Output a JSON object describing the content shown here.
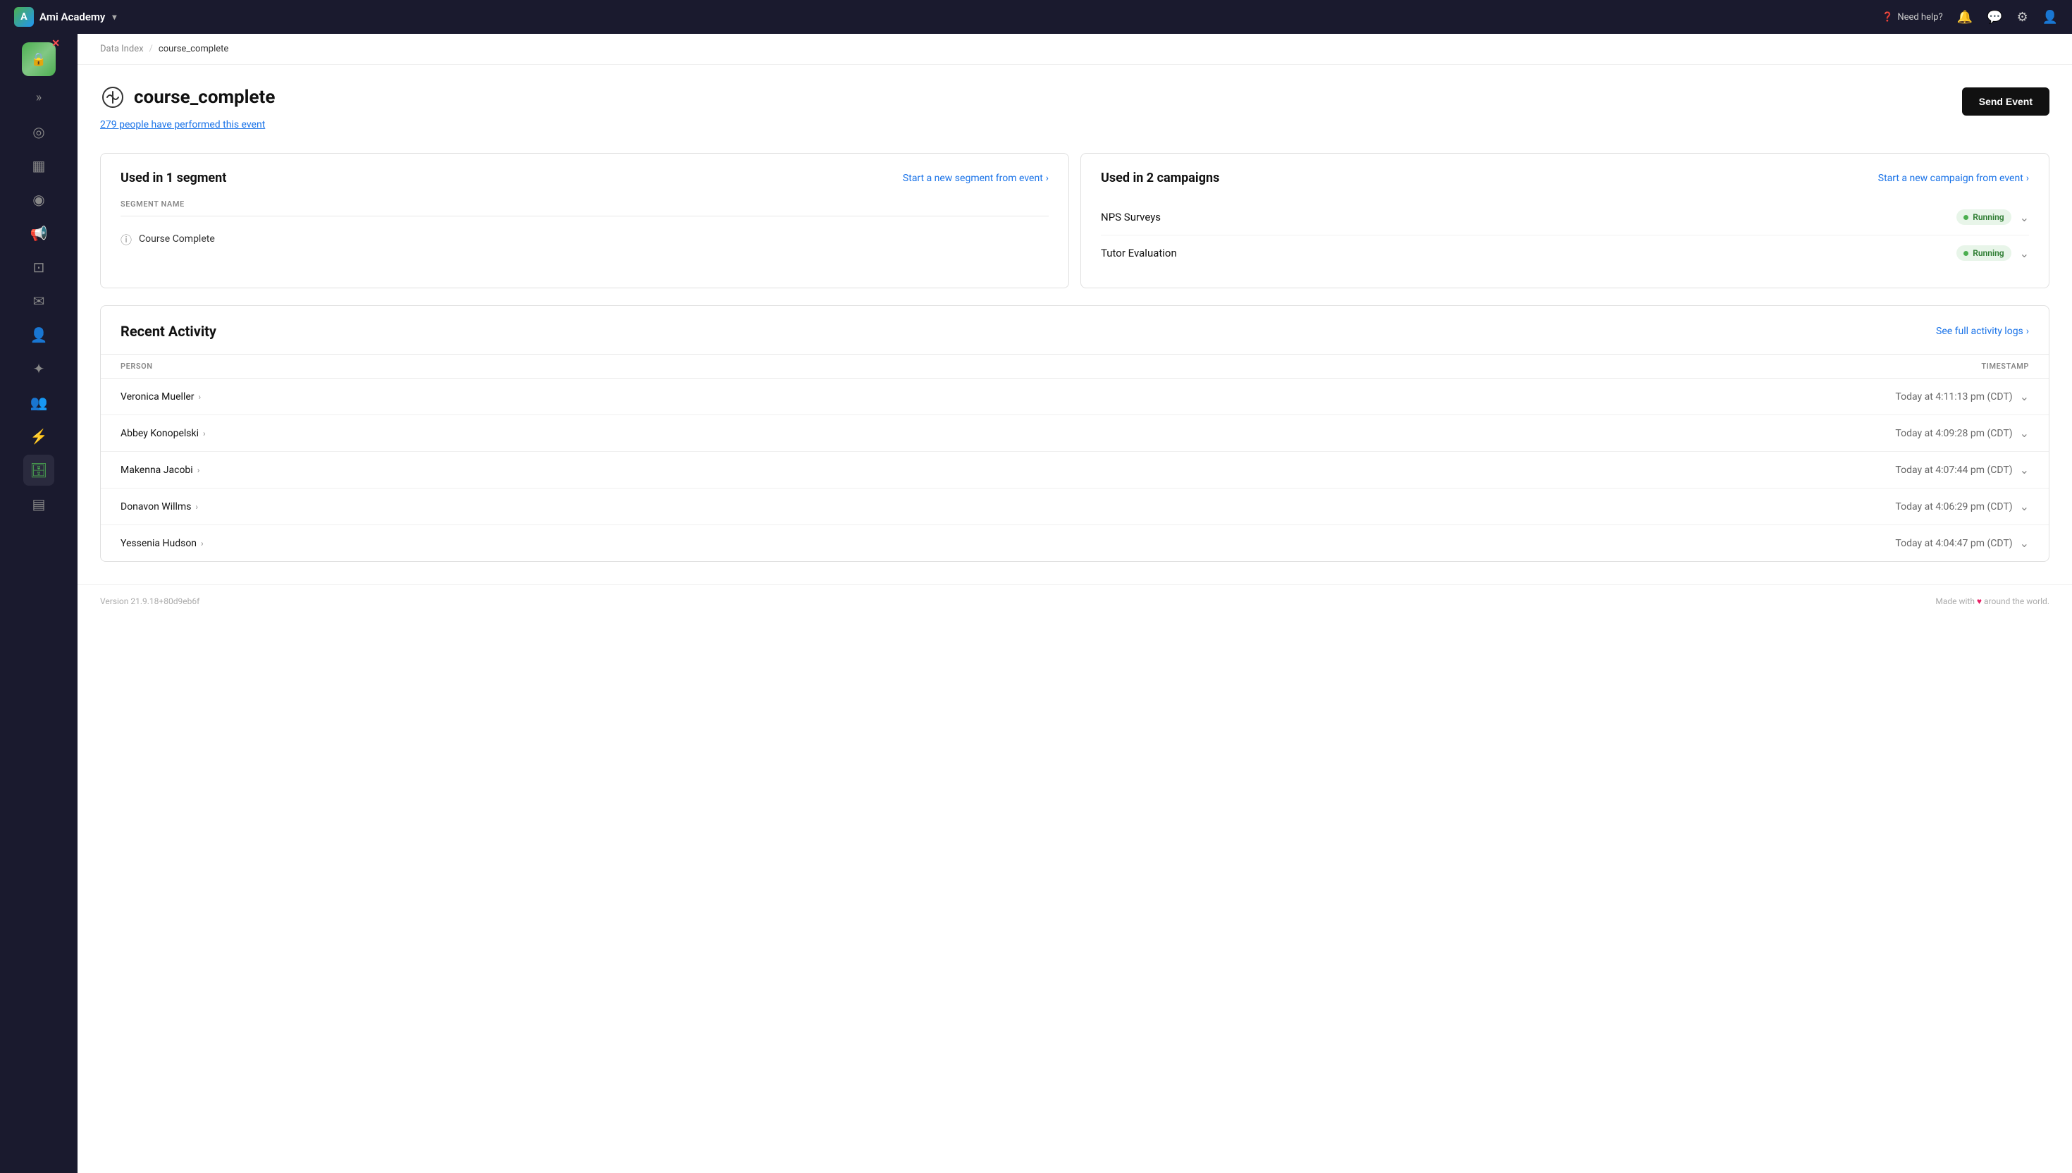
{
  "app": {
    "name": "Ami Academy",
    "version": "Version 21.9.18+80d9eb6f",
    "footer_text": "Made with",
    "footer_suffix": "around the world."
  },
  "topnav": {
    "help_label": "Need help?",
    "logo_initials": "A"
  },
  "breadcrumb": {
    "parent": "Data Index",
    "separator": "/",
    "current": "course_complete"
  },
  "page": {
    "event_name": "course_complete",
    "people_count": "279 people have performed this event",
    "send_event_label": "Send Event"
  },
  "segment_card": {
    "title": "Used in 1 segment",
    "link_label": "Start a new segment from event",
    "col_header": "SEGMENT NAME",
    "items": [
      {
        "name": "Course Complete"
      }
    ]
  },
  "campaign_card": {
    "title": "Used in 2 campaigns",
    "link_label": "Start a new campaign from event",
    "items": [
      {
        "name": "NPS Surveys",
        "status": "Running"
      },
      {
        "name": "Tutor Evaluation",
        "status": "Running"
      }
    ]
  },
  "activity": {
    "title": "Recent Activity",
    "link_label": "See full activity logs",
    "col_person": "PERSON",
    "col_timestamp": "TIMESTAMP",
    "rows": [
      {
        "name": "Veronica Mueller",
        "timestamp": "Today at 4:11:13 pm (CDT)"
      },
      {
        "name": "Abbey Konopelski",
        "timestamp": "Today at 4:09:28 pm (CDT)"
      },
      {
        "name": "Makenna Jacobi",
        "timestamp": "Today at 4:07:44 pm (CDT)"
      },
      {
        "name": "Donavon Willms",
        "timestamp": "Today at 4:06:29 pm (CDT)"
      },
      {
        "name": "Yessenia Hudson",
        "timestamp": "Today at 4:04:47 pm (CDT)"
      }
    ]
  },
  "sidebar": {
    "items": [
      {
        "icon": "◎",
        "label": "dashboard",
        "active": false
      },
      {
        "icon": "✕",
        "label": "close",
        "active": false
      },
      {
        "icon": "▦",
        "label": "analytics",
        "active": false
      },
      {
        "icon": "◎",
        "label": "targeting",
        "active": false
      },
      {
        "icon": "📢",
        "label": "campaigns",
        "active": false
      },
      {
        "icon": "⊡",
        "label": "terminal",
        "active": false
      },
      {
        "icon": "✉",
        "label": "inbox",
        "active": false
      },
      {
        "icon": "👤",
        "label": "people",
        "active": false
      },
      {
        "icon": "⚙",
        "label": "integrations",
        "active": false
      },
      {
        "icon": "👤",
        "label": "audience",
        "active": false
      },
      {
        "icon": "⚡",
        "label": "activity",
        "active": false
      },
      {
        "icon": "🗄",
        "label": "data-index",
        "active": true
      },
      {
        "icon": "▤",
        "label": "table",
        "active": false
      }
    ]
  }
}
